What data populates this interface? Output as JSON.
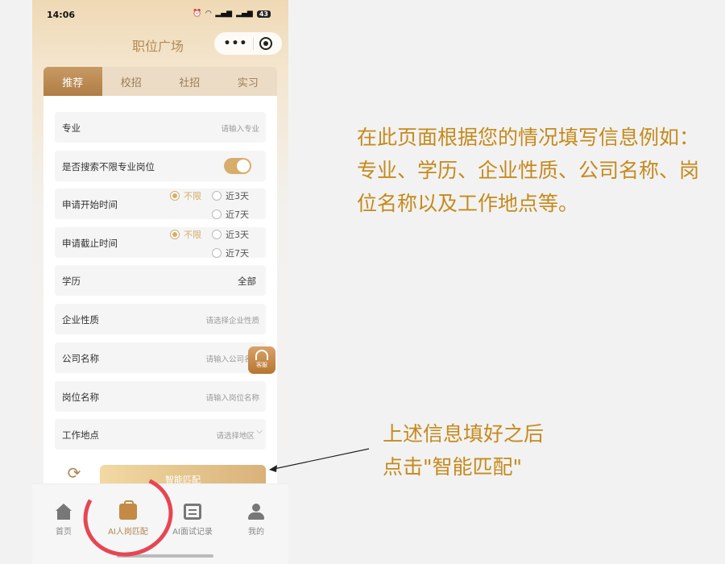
{
  "status_bar": {
    "time": "14:06",
    "icons": [
      "alarm-icon",
      "wifi-icon",
      "signal-icon",
      "signal-icon"
    ],
    "battery": "43"
  },
  "header": {
    "title": "职位广场"
  },
  "tabs": [
    {
      "label": "推荐",
      "active": true
    },
    {
      "label": "校招",
      "active": false
    },
    {
      "label": "社招",
      "active": false
    },
    {
      "label": "实习",
      "active": false
    }
  ],
  "form": {
    "major": {
      "label": "专业",
      "placeholder": "请输入专业"
    },
    "unlimited_major": {
      "label": "是否搜索不限专业岗位",
      "on": true
    },
    "apply_start": {
      "label": "申请开始时间",
      "options": [
        "不限",
        "近3天",
        "近7天"
      ],
      "selected": "不限"
    },
    "apply_end": {
      "label": "申请截止时间",
      "options": [
        "不限",
        "近3天",
        "近7天"
      ],
      "selected": "不限"
    },
    "education": {
      "label": "学历",
      "value": "全部"
    },
    "company_type": {
      "label": "企业性质",
      "placeholder": "请选择企业性质"
    },
    "company_name": {
      "label": "公司名称",
      "placeholder": "请输入公司名称"
    },
    "position_name": {
      "label": "岗位名称",
      "placeholder": "请输入岗位名称"
    },
    "location": {
      "label": "工作地点",
      "placeholder": "请选择地区"
    }
  },
  "service_button": {
    "label": "客服"
  },
  "actions": {
    "reset_label": "重置",
    "match_label": "智能匹配"
  },
  "tabbar": [
    {
      "label": "首页",
      "icon": "home-icon"
    },
    {
      "label": "AI人岗匹配",
      "icon": "briefcase-icon",
      "active": true
    },
    {
      "label": "AI面试记录",
      "icon": "calendar-icon"
    },
    {
      "label": "我的",
      "icon": "user-icon"
    }
  ],
  "annotations": {
    "note1": "在此页面根据您的情况填写信息例如：专业、学历、企业性质、公司名称、岗位名称以及工作地点等。",
    "note2_line1": "上述信息填好之后",
    "note2_line2": "点击\"智能匹配\""
  },
  "colors": {
    "accent": "#b08650",
    "annotation_text": "#c58a1c",
    "annotation_circle": "#e64653"
  }
}
